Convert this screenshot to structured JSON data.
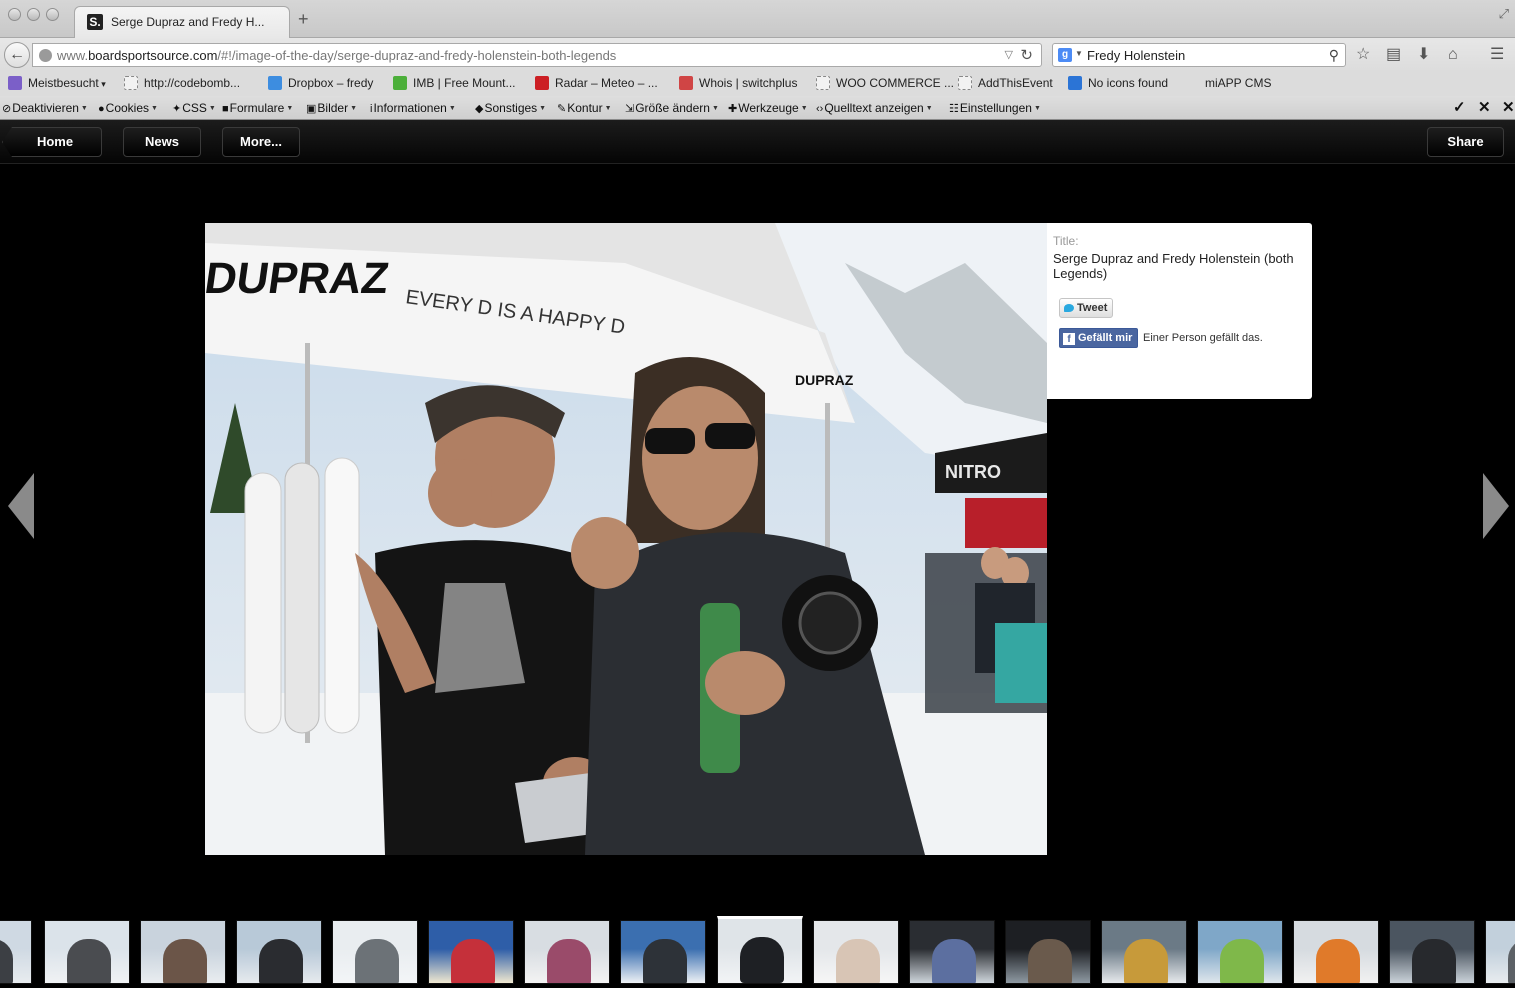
{
  "browser": {
    "tab_title": "Serge Dupraz and Fredy H...",
    "tab_favicon": "S.",
    "url_prefix": "www.",
    "url_domain": "boardsportsource.com",
    "url_path": "/#!/image-of-the-day/serge-dupraz-and-fredy-holenstein-both-legends",
    "search_value": "Fredy Holenstein",
    "icons": [
      "back-arrow-icon",
      "globe-icon",
      "reload-icon",
      "google-icon",
      "search-icon",
      "star-icon",
      "clipboard-icon",
      "download-icon",
      "home-icon",
      "menu-icon"
    ]
  },
  "bookmarks": [
    {
      "label": "Meistbesucht",
      "icon": "most-visited-icon",
      "color": "#7b5fc8"
    },
    {
      "label": "http://codebomb...",
      "icon": "page-icon",
      "color": ""
    },
    {
      "label": "Dropbox – fredy",
      "icon": "dropbox-icon",
      "color": "#3d8de0"
    },
    {
      "label": "IMB | Free Mount...",
      "icon": "imb-icon",
      "color": "#4caf3a"
    },
    {
      "label": "Radar – Meteo – ...",
      "icon": "srf-icon",
      "color": "#cc1f24"
    },
    {
      "label": "Whois | switchplus",
      "icon": "switchplus-icon",
      "color": "#d04545"
    },
    {
      "label": "WOO COMMERCE ...",
      "icon": "page-icon",
      "color": ""
    },
    {
      "label": "AddThisEvent",
      "icon": "page-icon",
      "color": ""
    },
    {
      "label": "No icons found",
      "icon": "id-icon",
      "color": "#2b74d6"
    },
    {
      "label": "miAPP CMS",
      "icon": "none",
      "color": ""
    }
  ],
  "devtools": [
    {
      "label": "Deaktivieren",
      "icon": "forbidden-icon"
    },
    {
      "label": "Cookies",
      "icon": "user-icon"
    },
    {
      "label": "CSS",
      "icon": "wand-icon"
    },
    {
      "label": "Formulare",
      "icon": "briefcase-icon"
    },
    {
      "label": "Bilder",
      "icon": "image-icon"
    },
    {
      "label": "Informationen",
      "icon": "info-icon"
    },
    {
      "label": "Sonstiges",
      "icon": "cube-icon"
    },
    {
      "label": "Kontur",
      "icon": "pencil-icon"
    },
    {
      "label": "Größe ändern",
      "icon": "resize-icon"
    },
    {
      "label": "Werkzeuge",
      "icon": "wrench-icon"
    },
    {
      "label": "Quelltext anzeigen",
      "icon": "code-icon"
    },
    {
      "label": "Einstellungen",
      "icon": "sliders-icon"
    }
  ],
  "site_nav": {
    "home": "Home",
    "news": "News",
    "more": "More...",
    "share": "Share"
  },
  "photo": {
    "description_icon": "photo-image",
    "alt": "Serge Dupraz and Fredy Holenstein (both Legends)"
  },
  "info": {
    "label": "Title:",
    "title": "Serge Dupraz and Fredy Holenstein (both Legends)",
    "tweet": "Tweet",
    "like": "Gefällt mir",
    "like_count_text": "Einer Person gefällt das."
  },
  "colors": {
    "page_bg": "#000000",
    "toolbar_bg": "#0d0d0d",
    "fb_blue": "#4a66a0",
    "twitter_blue": "#2aa9e0"
  },
  "thumbnails": {
    "count": 16,
    "active_index": 7
  }
}
